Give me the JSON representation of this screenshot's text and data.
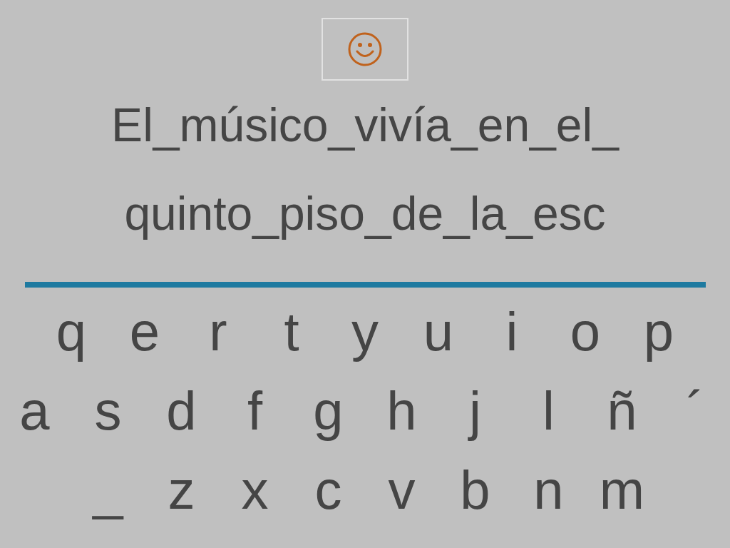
{
  "sentence_lines": [
    "El_músico_vivía_en_el_",
    "quinto_piso_de_la_esc"
  ],
  "keyboard": {
    "rows": [
      [
        "q",
        "e",
        "r",
        "t",
        "y",
        "u",
        "i",
        "o",
        "p"
      ],
      [
        "a",
        "s",
        "d",
        "f",
        "g",
        "h",
        "j",
        "l",
        "ñ",
        "´"
      ],
      [
        "_",
        "z",
        "x",
        "c",
        "v",
        "b",
        "n",
        "m"
      ]
    ]
  }
}
